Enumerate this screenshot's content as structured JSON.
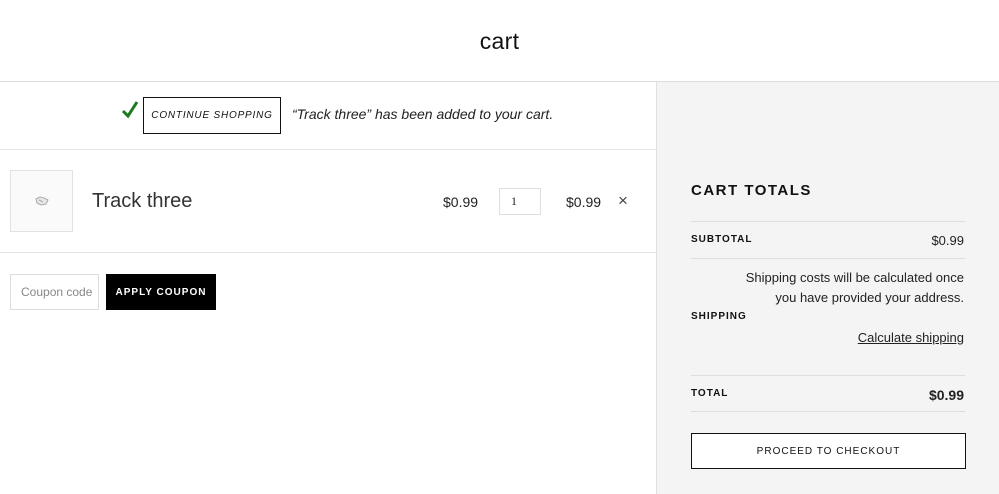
{
  "header": {
    "title": "cart"
  },
  "notice": {
    "continue_label": "Continue Shopping",
    "message": "“Track three” has been added to your cart."
  },
  "cart": {
    "items": [
      {
        "name": "Track three",
        "price": "$0.99",
        "quantity": "1",
        "subtotal": "$0.99"
      }
    ],
    "coupon_placeholder": "Coupon code",
    "apply_coupon_label": "Apply coupon"
  },
  "totals": {
    "title": "Cart totals",
    "subtotal_label": "Subtotal",
    "subtotal_value": "$0.99",
    "shipping_label": "Shipping",
    "shipping_note": "Shipping costs will be calculated once you have provided your address.",
    "calc_shipping_label": "Calculate shipping",
    "total_label": "Total",
    "total_value": "$0.99",
    "checkout_label": "Proceed to checkout"
  },
  "colors": {
    "check": "#1e7a1e",
    "sidebar_bg": "#f4f4f4",
    "button_dark": "#000000"
  },
  "icons": {
    "check": "check-icon",
    "thumb": "placeholder-image-icon",
    "remove": "close-icon"
  }
}
